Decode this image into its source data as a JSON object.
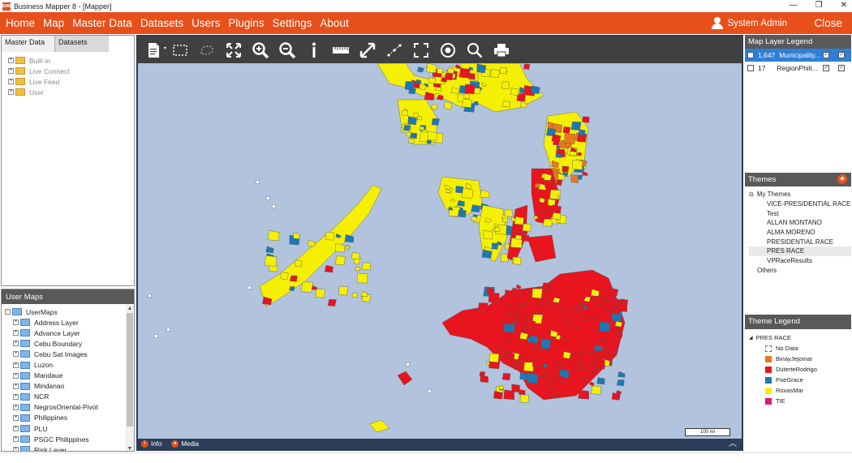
{
  "window": {
    "title": "Business Mapper 8 - [Mapper]",
    "app_icon_text": "BM8",
    "minimize_icon": "minimize-icon",
    "maximize_icon": "maximize-icon",
    "close_icon": "close-icon"
  },
  "menu": {
    "items": [
      "Home",
      "Map",
      "Master Data",
      "Datasets",
      "Users",
      "Plugins",
      "Settings",
      "About"
    ],
    "user_label": "System Admin",
    "close_label": "Close",
    "accent": "#e8501b"
  },
  "left_panel": {
    "tabs": [
      "Master Data",
      "Datasets"
    ],
    "tree": [
      "Built-in",
      "Live Connect",
      "Live Feed",
      "User"
    ]
  },
  "user_maps": {
    "header": "User Maps",
    "root": "UserMaps",
    "items": [
      "Address Layer",
      "Advance Layer",
      "Cebu Boundary",
      "Cebu Sat Images",
      "Luzon",
      "Mandaue",
      "Mindanao",
      "NCR",
      "NegrosOriental-Pivot",
      "Philippines",
      "PLU",
      "PSGC Philippines",
      "Risk Layer"
    ]
  },
  "toolbar": {
    "tools": [
      "new-document-icon",
      "rectangle-select-icon",
      "lasso-select-icon",
      "zoom-extent-icon",
      "zoom-in-icon",
      "zoom-out-icon",
      "info-icon",
      "measure-ruler-icon",
      "full-extent-arrows-icon",
      "route-path-icon",
      "fullscreen-icon",
      "target-icon",
      "search-icon",
      "print-icon"
    ]
  },
  "map": {
    "scale_label": "100 mi",
    "status": [
      "Info",
      "Media"
    ],
    "colors": {
      "water": "#b2c3de",
      "duterte": "#e8141e",
      "roxas": "#f5f000",
      "poe": "#1e78b4",
      "binay": "#e8781e"
    }
  },
  "layer_legend": {
    "header": "Map Layer Legend",
    "layers": [
      {
        "count": "1,647",
        "name": "Municipality..."
      },
      {
        "count": "17",
        "name": "RegionPhili..."
      }
    ]
  },
  "themes": {
    "header": "Themes",
    "group": "My Themes",
    "items": [
      "VICE-PRESIDENTIAL RACE",
      "Test",
      "ALLAN MONTANO",
      "ALMA MORENO",
      "PRESIDENTIAL RACE",
      "PRES RACE",
      "VPRaceResults"
    ],
    "others": "Others",
    "selected": "PRES RACE"
  },
  "theme_legend": {
    "header": "Theme Legend",
    "theme": "PRES RACE",
    "entries": [
      {
        "label": "No Data",
        "color": "#ffffff"
      },
      {
        "label": "BinayJejomar",
        "color": "#e8781e"
      },
      {
        "label": "DuterteRodrigo",
        "color": "#e8141e"
      },
      {
        "label": "PoeGrace",
        "color": "#1e78b4"
      },
      {
        "label": "RoxasMar",
        "color": "#f5f000"
      },
      {
        "label": "TIE",
        "color": "#e0147a"
      }
    ]
  }
}
